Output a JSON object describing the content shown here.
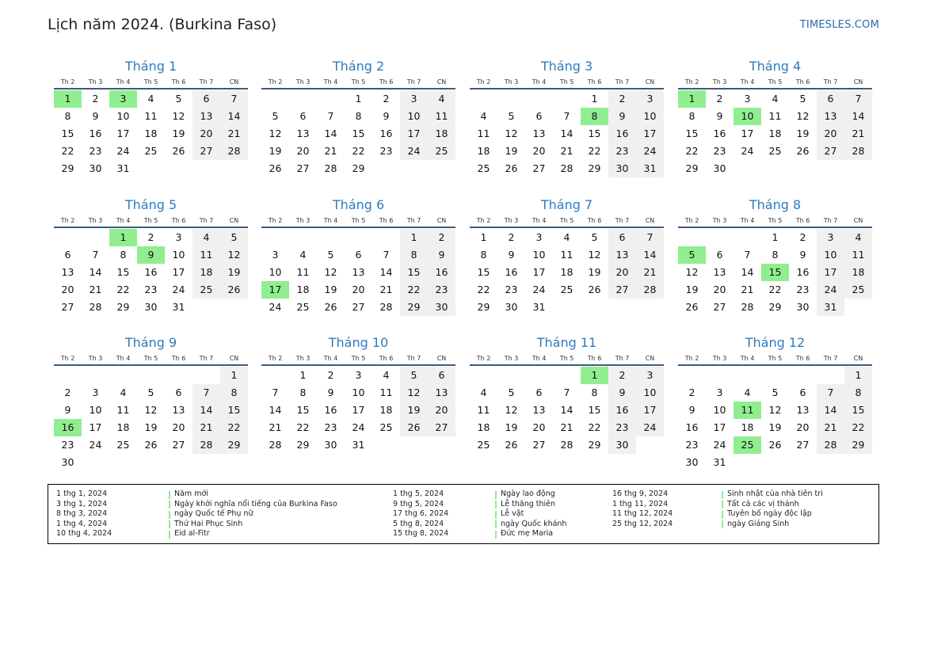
{
  "header": {
    "title": "Lịch năm 2024. (Burkina Faso)",
    "site": "TIMESLES.COM"
  },
  "calendar": {
    "weekday_labels": [
      "Th 2",
      "Th 3",
      "Th 4",
      "Th 5",
      "Th 6",
      "Th 7",
      "CN"
    ],
    "weekend_columns": [
      5,
      6
    ],
    "months": [
      {
        "name": "Tháng 1",
        "offset": 0,
        "days": 31,
        "holidays": [
          1,
          3
        ]
      },
      {
        "name": "Tháng 2",
        "offset": 3,
        "days": 29,
        "holidays": []
      },
      {
        "name": "Tháng 3",
        "offset": 4,
        "days": 31,
        "holidays": [
          8
        ]
      },
      {
        "name": "Tháng 4",
        "offset": 0,
        "days": 30,
        "holidays": [
          1,
          10
        ]
      },
      {
        "name": "Tháng 5",
        "offset": 2,
        "days": 31,
        "holidays": [
          1,
          9
        ]
      },
      {
        "name": "Tháng 6",
        "offset": 5,
        "days": 30,
        "holidays": [
          17
        ]
      },
      {
        "name": "Tháng 7",
        "offset": 0,
        "days": 31,
        "holidays": []
      },
      {
        "name": "Tháng 8",
        "offset": 3,
        "days": 31,
        "holidays": [
          5,
          15
        ]
      },
      {
        "name": "Tháng 9",
        "offset": 6,
        "days": 30,
        "holidays": [
          16
        ]
      },
      {
        "name": "Tháng 10",
        "offset": 1,
        "days": 31,
        "holidays": []
      },
      {
        "name": "Tháng 11",
        "offset": 4,
        "days": 30,
        "holidays": [
          1
        ]
      },
      {
        "name": "Tháng 12",
        "offset": 6,
        "days": 31,
        "holidays": [
          11,
          25
        ]
      }
    ]
  },
  "holidays_legend": [
    [
      {
        "date": "1 thg 1, 2024",
        "name": "Năm mới"
      },
      {
        "date": "3 thg 1, 2024",
        "name": "Ngày khởi nghĩa nổi tiếng của Burkina Faso"
      },
      {
        "date": "8 thg 3, 2024",
        "name": "ngày Quốc tế Phụ nữ"
      },
      {
        "date": "1 thg 4, 2024",
        "name": "Thứ Hai Phục Sinh"
      },
      {
        "date": "10 thg 4, 2024",
        "name": "Eid al-Fitr"
      }
    ],
    [
      {
        "date": "1 thg 5, 2024",
        "name": "Ngày lao động"
      },
      {
        "date": "9 thg 5, 2024",
        "name": "Lễ thăng thiên"
      },
      {
        "date": "17 thg 6, 2024",
        "name": "Lễ vật"
      },
      {
        "date": "5 thg 8, 2024",
        "name": "ngày Quốc khánh"
      },
      {
        "date": "15 thg 8, 2024",
        "name": "Đức mẹ Maria"
      }
    ],
    [
      {
        "date": "16 thg 9, 2024",
        "name": "Sinh nhật của nhà tiên tri"
      },
      {
        "date": "1 thg 11, 2024",
        "name": "Tất cả các vị thánh"
      },
      {
        "date": "11 thg 12, 2024",
        "name": "Tuyên bố ngày độc lập"
      },
      {
        "date": "25 thg 12, 2024",
        "name": "ngày Giáng Sinh"
      }
    ]
  ],
  "colors": {
    "holiday": "#90ee90",
    "weekend": "#f0f0f0",
    "month_title": "#2f7bbd",
    "link": "#2a6aa8"
  }
}
